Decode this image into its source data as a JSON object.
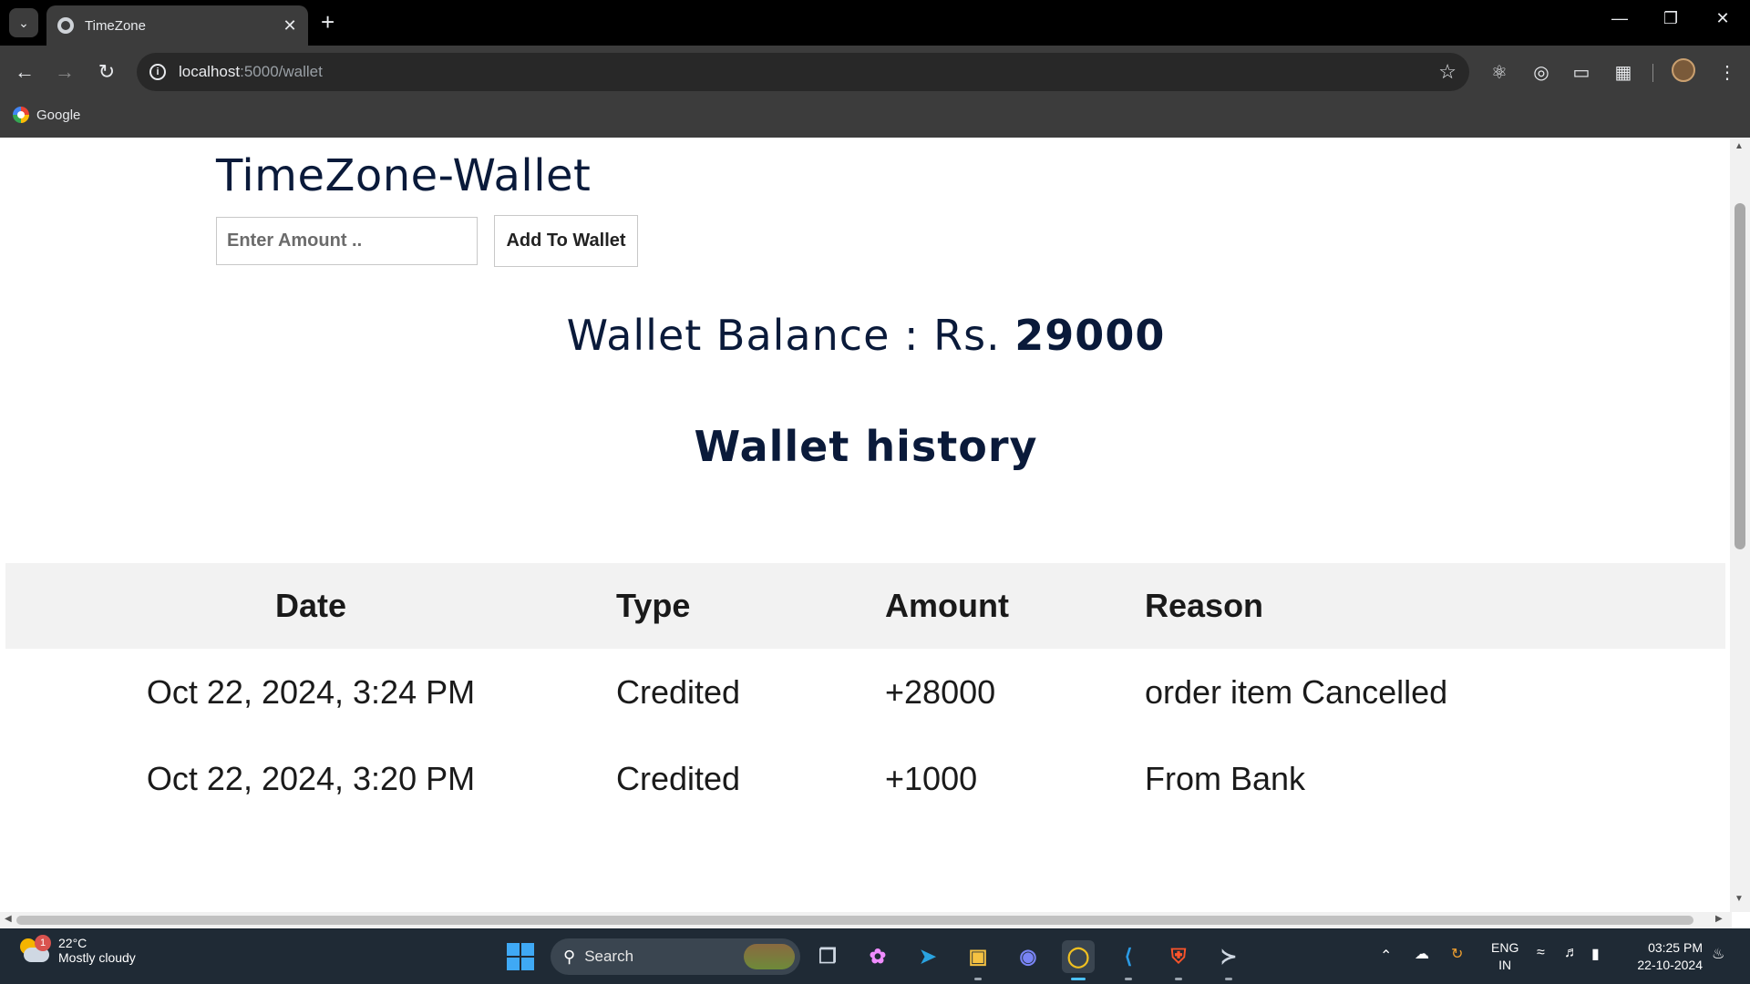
{
  "browser": {
    "tab_title": "TimeZone",
    "url_host": "localhost",
    "url_rest": ":5000/wallet",
    "bookmark_label": "Google",
    "icons": {
      "tab_menu": "chevron-down-icon",
      "close_tab": "close-icon",
      "new_tab": "plus-icon",
      "back": "back-arrow-icon",
      "forward": "forward-arrow-icon",
      "reload": "reload-icon",
      "site_info": "info-icon",
      "bookmark_star": "star-icon",
      "menu": "kebab-menu-icon"
    }
  },
  "page": {
    "title": "TimeZone-Wallet",
    "amount_placeholder": "Enter Amount ..",
    "add_button": "Add To Wallet",
    "balance_label": "Wallet Balance : Rs.",
    "balance_value": "29000",
    "history_title": "Wallet history",
    "table": {
      "headers": [
        "Date",
        "Type",
        "Amount",
        "Reason"
      ],
      "rows": [
        {
          "date": "Oct 22, 2024, 3:24 PM",
          "type": "Credited",
          "amount": "+28000",
          "reason": "order item Cancelled"
        },
        {
          "date": "Oct 22, 2024, 3:20 PM",
          "type": "Credited",
          "amount": "+1000",
          "reason": "From Bank"
        }
      ]
    },
    "colors": {
      "heading": "#0a1a3a",
      "credit": "#0b7a0b",
      "table_header_bg": "#f2f2f2"
    }
  },
  "taskbar": {
    "weather_badge": "1",
    "weather_temp": "22°C",
    "weather_desc": "Mostly cloudy",
    "search_label": "Search",
    "lang_top": "ENG",
    "lang_bottom": "IN",
    "time": "03:25 PM",
    "date": "22-10-2024"
  }
}
